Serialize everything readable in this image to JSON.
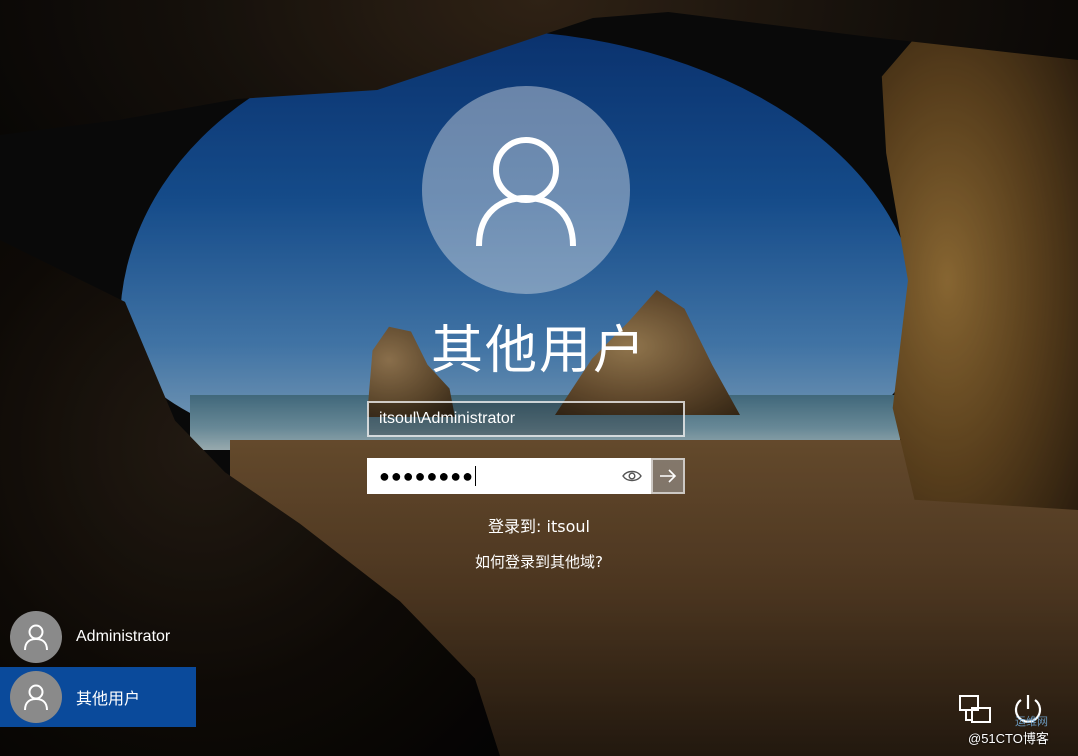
{
  "login": {
    "title": "其他用户",
    "username_value": "itsoul\\Administrator",
    "password_mask": "●●●●●●●●",
    "signin_to": "登录到: itsoul",
    "other_domain_link": "如何登录到其他域?"
  },
  "users": [
    {
      "name": "Administrator",
      "selected": false
    },
    {
      "name": "其他用户",
      "selected": true
    }
  ],
  "icons": {
    "avatar": "user-icon",
    "reveal": "eye-icon",
    "submit": "arrow-right-icon",
    "network": "network-icon",
    "power": "power-icon"
  },
  "colors": {
    "selected_user": "#0a4a9b"
  },
  "watermark": {
    "text": "@51CTO博客",
    "site": "运维网"
  }
}
